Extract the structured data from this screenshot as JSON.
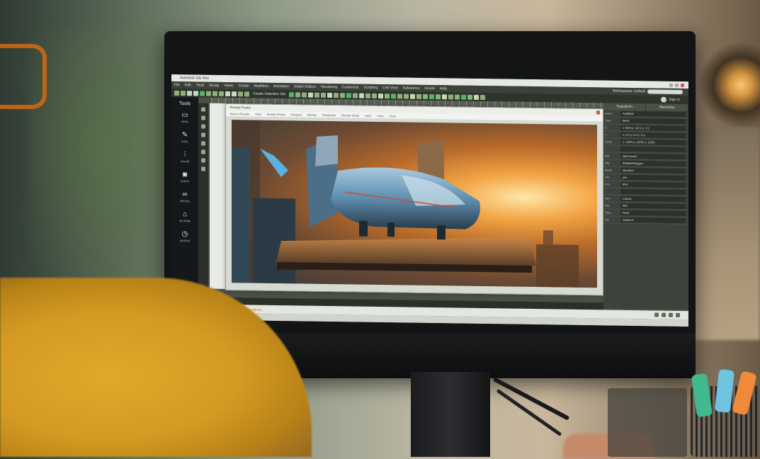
{
  "app": {
    "title": "Autodesk 3ds Max",
    "menu": [
      "File",
      "Edit",
      "Tools",
      "Group",
      "Views",
      "Create",
      "Modifiers",
      "Animation",
      "Graph Editors",
      "Rendering",
      "Customize",
      "Scripting",
      "Civil View",
      "Substance",
      "Arnold",
      "Help"
    ],
    "workspace_label": "Workspaces: Default",
    "signin_label": "Sign In",
    "selection_label": "Create Selection Set"
  },
  "tools": {
    "title": "Tools",
    "items": [
      {
        "label": "OPEN",
        "icon": "folder-icon",
        "glyph": "▭"
      },
      {
        "label": "PIXEL",
        "icon": "pencil-icon",
        "glyph": "✎"
      },
      {
        "label": "COLOR",
        "icon": "sliders-icon",
        "glyph": "⫶"
      },
      {
        "label": "PHOTO",
        "icon": "camera-icon",
        "glyph": "◙"
      },
      {
        "label": "SPECIAL",
        "icon": "glasses-icon",
        "glyph": "∞"
      },
      {
        "label": "3D HOME",
        "icon": "home-icon",
        "glyph": "⌂"
      },
      {
        "label": "SEARCH",
        "icon": "clock-icon",
        "glyph": "◷"
      }
    ]
  },
  "render_window": {
    "title": "Render Frame",
    "menu": [
      "Area to Render",
      "View",
      "Render Preset",
      "Viewport",
      "Render",
      "Production",
      "Render Setup",
      "Save",
      "Copy",
      "Clear"
    ]
  },
  "props": {
    "tabs": [
      "Transform",
      "Hierarchy"
    ],
    "rows": [
      {
        "k": "Name",
        "v": "#168618"
      },
      {
        "k": "Type",
        "v": "Mesh"
      },
      {
        "k": "X",
        "v": "x: 86.9   y: 112.2   z: 0.1"
      },
      {
        "k": "Y",
        "v": "x: 0.0   y: 0.0   z: 0.0"
      },
      {
        "k": "Scale",
        "v": "x: 100%   y: 100%   z: 100%"
      },
      {
        "k": "",
        "v": ""
      },
      {
        "k": "Mat",
        "v": "sand scene"
      },
      {
        "k": "Obj",
        "v": "EditablePolygon"
      },
      {
        "k": "Mode",
        "v": "standard"
      },
      {
        "k": "Ver",
        "v": "yes"
      },
      {
        "k": "Fmt",
        "v": "IPVI"
      },
      {
        "k": "",
        "v": ""
      },
      {
        "k": "Gen",
        "v": "Clouds"
      },
      {
        "k": "Out",
        "v": "RIS"
      },
      {
        "k": "Type",
        "v": "Float"
      },
      {
        "k": "Var",
        "v": "Variance"
      }
    ]
  },
  "timeline": {
    "frame_label": "0 / 100"
  },
  "status": {
    "text": "1 Object Selected",
    "hint": "Click or click-and-drag to select objects"
  },
  "colors": {
    "screen_bg": "#4a5045",
    "tools_bg": "#15181a",
    "accent_orange": "#d56a10",
    "sweater": "#d49a22"
  }
}
